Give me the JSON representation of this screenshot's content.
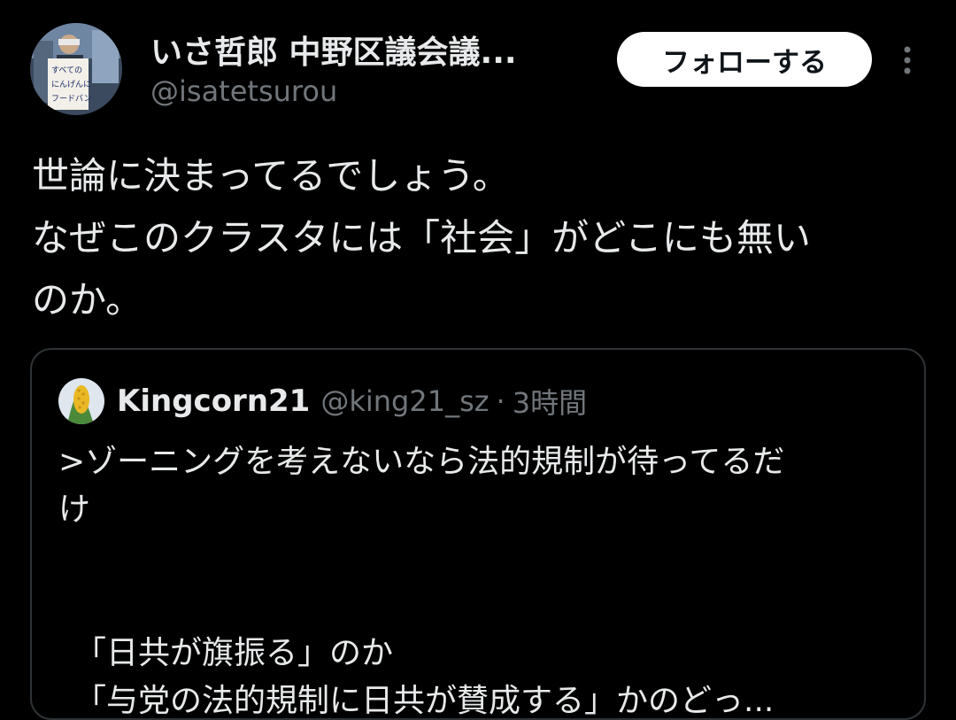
{
  "author": {
    "name": "いさ哲郎 中野区議会議...",
    "handle": "@isatetsurou",
    "avatar_icon": "profile-photo-avatar",
    "avatar_sign_text": [
      "すべての",
      "にんげんに",
      "フードバン"
    ]
  },
  "follow_button": {
    "label": "フォローする"
  },
  "more_menu": {
    "icon": "more-vertical-icon"
  },
  "tweet": {
    "lines": [
      "世論に決まってるでしょう。",
      "なぜこのクラスタには「社会」がどこにも無い",
      "のか。"
    ]
  },
  "quote": {
    "avatar_icon": "corn-avatar",
    "name": "Kingcorn21",
    "handle": "@king21_sz",
    "separator": "·",
    "time": "3時間",
    "lines": [
      ">ゾーニングを考えないなら法的規制が待ってるだ",
      "け",
      "",
      "",
      "「日共が旗振る」のか",
      "「与党の法的規制に日共が賛成する」かのどっ..."
    ]
  },
  "colors": {
    "background": "#000000",
    "text_primary": "#e7e9ea",
    "text_secondary": "#71767b",
    "card_border": "#2f3336",
    "follow_bg": "#ffffff",
    "follow_text": "#0f1419"
  }
}
